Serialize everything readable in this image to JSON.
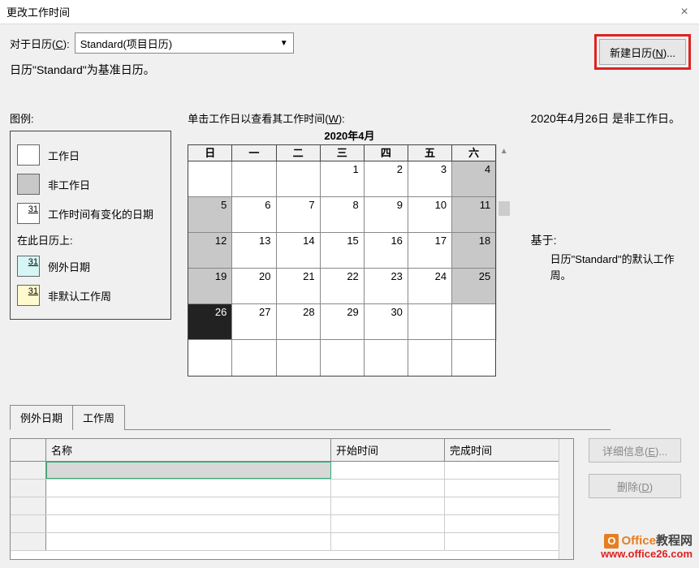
{
  "titlebar": {
    "title": "更改工作时间",
    "close": "×"
  },
  "top": {
    "for_calendar_label": "对于日历(C):",
    "dropdown_value": "Standard(项目日历)",
    "new_calendar_label": "新建日历(N)...",
    "base_text": "日历\"Standard\"为基准日历。"
  },
  "legend": {
    "title": "图例:",
    "items": {
      "work": "工作日",
      "nonwork": "非工作日",
      "changed": "工作时间有变化的日期",
      "changed_num": "31"
    },
    "subtitle": "在此日历上:",
    "subitems": {
      "except": "例外日期",
      "except_num": "31",
      "nondef": "非默认工作周",
      "nondef_num": "31"
    }
  },
  "calendar": {
    "click_label": "单击工作日以查看其工作时间(W):",
    "month_title": "2020年4月",
    "weekdays": [
      "日",
      "一",
      "二",
      "三",
      "四",
      "五",
      "六"
    ],
    "rows": [
      [
        null,
        null,
        null,
        "1",
        "2",
        "3",
        "4"
      ],
      [
        "5",
        "6",
        "7",
        "8",
        "9",
        "10",
        "11"
      ],
      [
        "12",
        "13",
        "14",
        "15",
        "16",
        "17",
        "18"
      ],
      [
        "19",
        "20",
        "21",
        "22",
        "23",
        "24",
        "25"
      ],
      [
        "26",
        "27",
        "28",
        "29",
        "30",
        null,
        null
      ],
      [
        null,
        null,
        null,
        null,
        null,
        null,
        null
      ]
    ]
  },
  "right": {
    "date_line": "2020年4月26日 是非工作日。",
    "based_label": "基于:",
    "based_text": "日历\"Standard\"的默认工作周。"
  },
  "tabs": {
    "tab1": "例外日期",
    "tab2": "工作周",
    "columns": {
      "name": "名称",
      "start": "开始时间",
      "end": "完成时间"
    }
  },
  "buttons": {
    "detail": "详细信息(E)...",
    "delete": "删除(D)"
  },
  "watermark": {
    "line1a": "Office",
    "line1b": "教程网",
    "line2": "www.office26.com"
  }
}
